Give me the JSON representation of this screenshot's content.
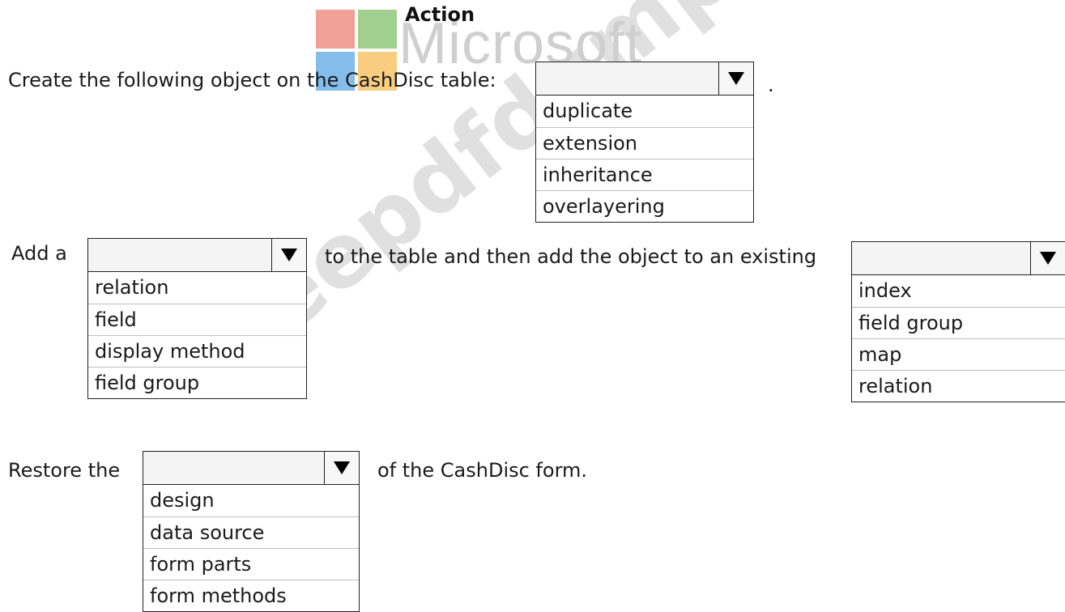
{
  "logo": {
    "title": "Action",
    "wordmark": "Microsoft"
  },
  "watermark": "freepdfdumps.com",
  "row1": {
    "prefix": "Create the following object on the CashDisc table:",
    "suffix": ".",
    "options": [
      "duplicate",
      "extension",
      "inheritance",
      "overlayering"
    ]
  },
  "row2": {
    "prefix": "Add a",
    "middle": "to the table and then add the object to an existing",
    "options_a": [
      "relation",
      "field",
      "display method",
      "field group"
    ],
    "options_b": [
      "index",
      "field group",
      "map",
      "relation"
    ]
  },
  "row3": {
    "prefix": "Restore the",
    "suffix": "of the CashDisc form.",
    "options": [
      "design",
      "data source",
      "form parts",
      "form methods"
    ]
  },
  "icons": {
    "dropdown": "dropdown-arrow-icon"
  }
}
